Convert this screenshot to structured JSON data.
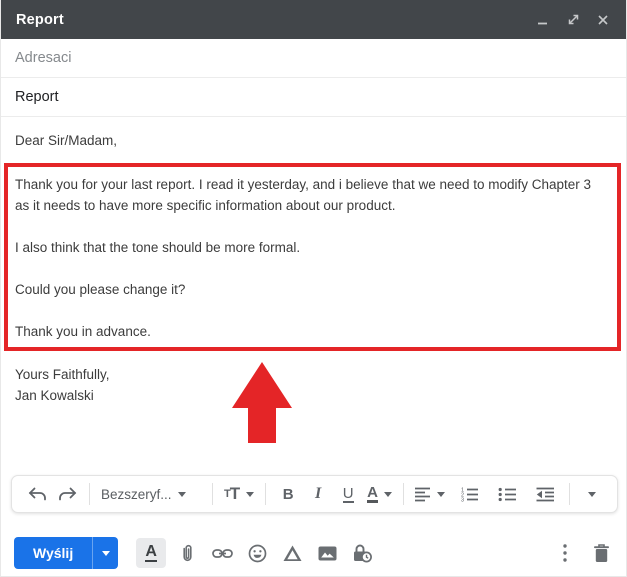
{
  "window": {
    "title": "Report"
  },
  "titlebar": {
    "icons": [
      "minimize-icon",
      "expand-icon",
      "close-icon"
    ]
  },
  "fields": {
    "recipients_placeholder": "Adresaci",
    "subject_value": "Report"
  },
  "body": {
    "greeting": "Dear Sir/Madam,",
    "highlighted_paragraphs": [
      "Thank you for your last report. I read it yesterday, and i believe that we need to modify Chapter 3 as it needs to have more specific information about our product.",
      "I also think that the tone should be more formal.",
      "Could you please change it?",
      "Thank you in advance."
    ],
    "closing": "Yours Faithfully,",
    "signature": "Jan Kowalski"
  },
  "annotations": {
    "highlight_box": "red rectangle around request paragraphs",
    "arrow": "red arrow pointing up at highlighted text",
    "red_color": "#e42527"
  },
  "toolbar": {
    "font_name": "Bezszeryf...",
    "size_small_t": "T",
    "size_large_t": "T",
    "bold_label": "B",
    "italic_label": "I",
    "underline_label": "U",
    "color_label": "A",
    "icons": [
      "undo-icon",
      "redo-icon",
      "align-left-icon",
      "numbered-list-icon",
      "bulleted-list-icon",
      "outdent-icon",
      "more-formats-icon"
    ]
  },
  "actions": {
    "send_label": "Wyślij",
    "icons": [
      "formatting-icon",
      "attach-icon",
      "insert-link-icon",
      "emoji-icon",
      "drive-icon",
      "insert-photo-icon",
      "confidential-mode-icon",
      "more-options-icon",
      "discard-draft-icon"
    ]
  },
  "colors": {
    "titlebar": "#42464a",
    "accent_blue": "#1a73e8",
    "annotation_red": "#e42527",
    "icon_gray": "#5f6368"
  }
}
